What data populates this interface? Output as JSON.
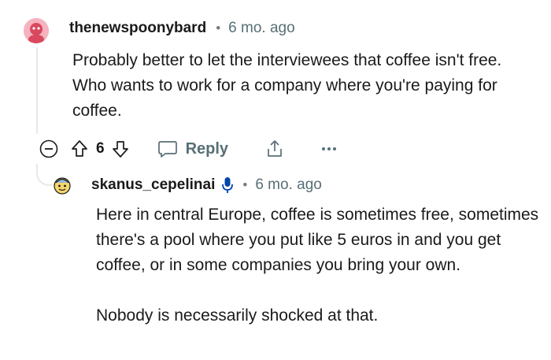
{
  "parent_comment": {
    "username": "thenewspoonybard",
    "separator": "•",
    "time": "6 mo. ago",
    "body": "Probably better to let the interviewees that coffee isn't free. Who wants to work for a company where you're paying for coffee.",
    "avatar_color": "#f2a5b2"
  },
  "actions": {
    "vote_count": "6",
    "reply_label": "Reply"
  },
  "reply_comment": {
    "username": "skanus_cepelinai",
    "separator": "•",
    "time": "6 mo. ago",
    "paragraphs": [
      "Here in central Europe, coffee is sometimes free, sometimes there's a pool where you put like 5 euros in and you get coffee, or in some companies you bring your own.",
      "Nobody is necessarily shocked at that."
    ],
    "mic_icon_color": "#0045ac"
  },
  "icons": {
    "collapse": "collapse-minus-icon",
    "upvote": "upvote-arrow-icon",
    "downvote": "downvote-arrow-icon",
    "reply": "comment-bubble-icon",
    "share": "share-icon",
    "more": "more-options-icon",
    "mic": "microphone-icon"
  }
}
